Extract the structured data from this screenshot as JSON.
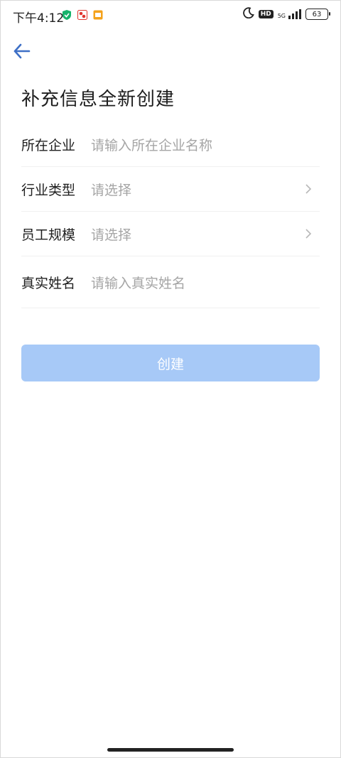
{
  "status_bar": {
    "time": "下午4:12",
    "network": "5G",
    "battery": "63"
  },
  "header": {
    "back_icon": "arrow-left-icon",
    "title": "补充信息全新创建"
  },
  "form": {
    "fields": [
      {
        "label": "所在企业",
        "placeholder": "请输入所在企业名称",
        "type": "input"
      },
      {
        "label": "行业类型",
        "placeholder": "请选择",
        "type": "select"
      },
      {
        "label": "员工规模",
        "placeholder": "请选择",
        "type": "select"
      },
      {
        "label": "真实姓名",
        "placeholder": "请输入真实姓名",
        "type": "input"
      }
    ]
  },
  "actions": {
    "create_label": "创建"
  },
  "colors": {
    "accent": "#3d6fc6",
    "button_disabled": "#a7c9f7",
    "placeholder": "#a5a5a5"
  }
}
